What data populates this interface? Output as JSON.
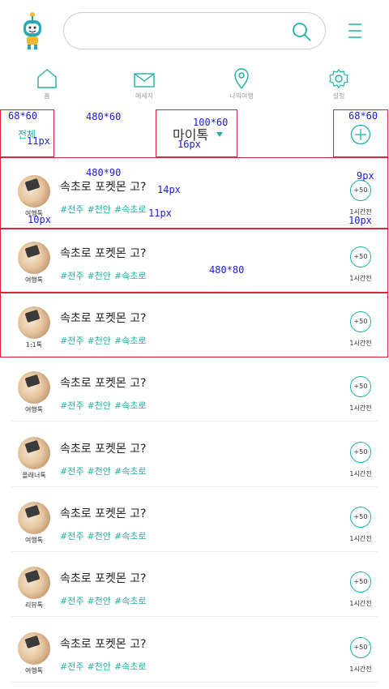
{
  "search": {
    "placeholder": "",
    "value": ""
  },
  "nav": [
    {
      "label": "홈",
      "icon": "home-icon"
    },
    {
      "label": "메세지",
      "icon": "mail-icon"
    },
    {
      "label": "나의여행",
      "icon": "map-pin-icon"
    },
    {
      "label": "설정",
      "icon": "gear-icon"
    }
  ],
  "filter": {
    "all_label": "전체",
    "title": "마이톡",
    "accent": "#21b1a4"
  },
  "annotations": [
    "68*60",
    "480*60",
    "100*60",
    "68*60",
    "11px",
    "16px",
    "480*90",
    "9px",
    "14px",
    "10px",
    "11px",
    "10px",
    "480*80"
  ],
  "posts": [
    {
      "category": "여행톡",
      "title": "속초로 포켓몬 고?",
      "tags": [
        "#전주",
        "#천안",
        "#속초로"
      ],
      "points": "+50",
      "time": "1시간전"
    },
    {
      "category": "여행톡",
      "title": "속초로 포켓몬 고?",
      "tags": [
        "#전주",
        "#천안",
        "#속초로"
      ],
      "points": "+50",
      "time": "1시간전"
    },
    {
      "category": "1:1톡",
      "title": "속초로 포켓몬 고?",
      "tags": [
        "#전주",
        "#천안",
        "#속초로"
      ],
      "points": "+50",
      "time": "1시간전"
    },
    {
      "category": "여행톡",
      "title": "속초로 포켓몬 고?",
      "tags": [
        "#전주",
        "#천안",
        "#속초로"
      ],
      "points": "+50",
      "time": "1시간전"
    },
    {
      "category": "플래너톡",
      "title": "속초로 포켓몬 고?",
      "tags": [
        "#전주",
        "#천안",
        "#속초로"
      ],
      "points": "+50",
      "time": "1시간전"
    },
    {
      "category": "여행톡",
      "title": "속초로 포켓몬 고?",
      "tags": [
        "#전주",
        "#천안",
        "#속초로"
      ],
      "points": "+50",
      "time": "1시간전"
    },
    {
      "category": "리뷰톡",
      "title": "속초로 포켓몬 고?",
      "tags": [
        "#전주",
        "#천안",
        "#속초로"
      ],
      "points": "+50",
      "time": "1시간전"
    },
    {
      "category": "여행톡",
      "title": "속초로 포켓몬 고?",
      "tags": [
        "#전주",
        "#천안",
        "#속초로"
      ],
      "points": "+50",
      "time": "1시간전"
    }
  ]
}
